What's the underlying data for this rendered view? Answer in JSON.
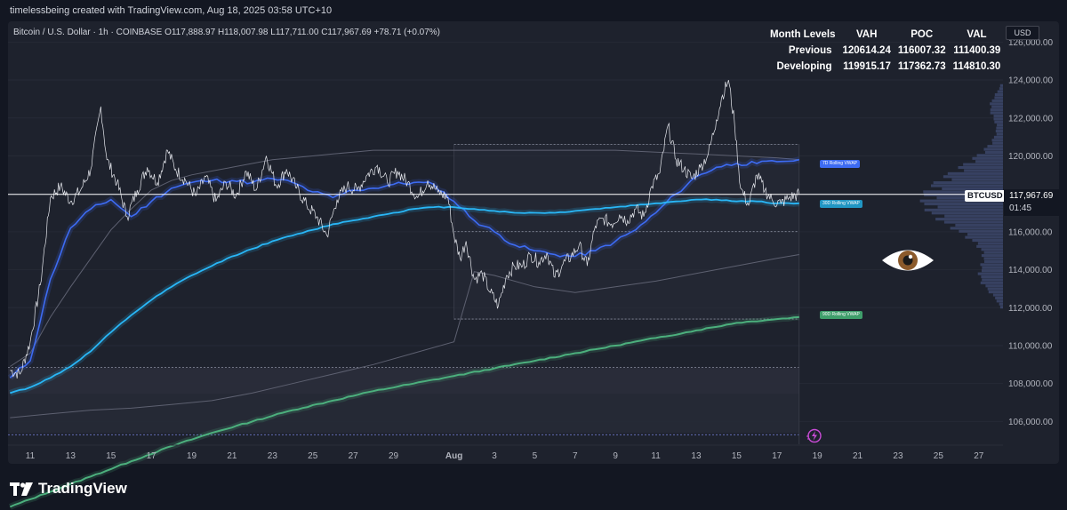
{
  "header": {
    "credit": "timelessbeing created with TradingView.com, Aug 18, 2025 03:58 UTC+10"
  },
  "legend": {
    "symbol": "Bitcoin / U.S. Dollar · 1h · COINBASE",
    "o_label": "O",
    "o_value": "117,888.97",
    "h_label": "H",
    "h_value": "118,007.98",
    "l_label": "L",
    "l_value": "117,711.00",
    "c_label": "C",
    "c_value": "117,967.69",
    "change": "+78.71 (+0.07%)"
  },
  "month_levels": {
    "headers": [
      "Month Levels",
      "VAH",
      "POC",
      "VAL"
    ],
    "rows": [
      {
        "name": "Previous",
        "vah": "120614.24",
        "poc": "116007.32",
        "val": "111400.39"
      },
      {
        "name": "Developing",
        "vah": "119915.17",
        "poc": "117362.73",
        "val": "114810.30"
      }
    ]
  },
  "price_scale": {
    "currency": "USD",
    "current_price": "117,967.69",
    "countdown": "01:45",
    "symbol_tag": "BTCUSD"
  },
  "vwap_tags": {
    "d7": "7D Rolling VWAP",
    "d30": "30D Rolling VWAP",
    "d90": "90D Rolling VWAP"
  },
  "footer": {
    "brand": "TradingView"
  },
  "icons": {
    "eye": "eye-icon",
    "bolt": "lightning-icon",
    "logo": "tradingview-logo-icon"
  },
  "colors": {
    "background": "#131722",
    "panel": "#1e222d",
    "vwap_7d": "#3d6bf2",
    "vwap_30d": "#29b6f6",
    "vwap_90d": "#4caf7d",
    "price_line": "#ffffff"
  },
  "chart_data": {
    "type": "line",
    "y_ticks": [
      106000,
      108000,
      110000,
      112000,
      114000,
      116000,
      118000,
      120000,
      122000,
      124000,
      126000
    ],
    "y_tick_labels": [
      "106,000.00",
      "108,000.00",
      "110,000.00",
      "112,000.00",
      "114,000.00",
      "116,000.00",
      "118,000.00",
      "120,000.00",
      "122,000.00",
      "124,000.00",
      "126,000.00"
    ],
    "ylim": [
      104800,
      127000
    ],
    "x_tick_labels": [
      "11",
      "13",
      "15",
      "17",
      "19",
      "21",
      "23",
      "25",
      "27",
      "29",
      "Aug",
      "3",
      "5",
      "7",
      "9",
      "11",
      "13",
      "15",
      "17",
      "19",
      "21",
      "23",
      "25",
      "27"
    ],
    "x_tick_days": [
      11,
      13,
      15,
      17,
      19,
      21,
      23,
      25,
      27,
      29,
      32,
      34,
      36,
      38,
      40,
      42,
      44,
      46,
      48,
      50,
      52,
      54,
      56,
      58
    ],
    "xlim": [
      9.9,
      59.2
    ],
    "last_day": 49.1,
    "price_series": [
      [
        10.0,
        108700
      ],
      [
        10.5,
        108500
      ],
      [
        11.0,
        110200
      ],
      [
        11.5,
        113200
      ],
      [
        12.0,
        117800
      ],
      [
        12.5,
        118400
      ],
      [
        13.0,
        117600
      ],
      [
        13.5,
        118200
      ],
      [
        14.0,
        119300
      ],
      [
        14.5,
        122600
      ],
      [
        14.8,
        119800
      ],
      [
        15.3,
        118600
      ],
      [
        15.8,
        116800
      ],
      [
        16.3,
        118200
      ],
      [
        16.8,
        119400
      ],
      [
        17.3,
        118600
      ],
      [
        17.8,
        120300
      ],
      [
        18.2,
        119300
      ],
      [
        18.7,
        118700
      ],
      [
        19.2,
        117900
      ],
      [
        19.7,
        118900
      ],
      [
        20.2,
        117600
      ],
      [
        20.7,
        118600
      ],
      [
        21.2,
        117900
      ],
      [
        21.7,
        119200
      ],
      [
        22.2,
        118200
      ],
      [
        22.7,
        120000
      ],
      [
        23.2,
        118400
      ],
      [
        23.7,
        119300
      ],
      [
        24.2,
        118300
      ],
      [
        24.7,
        117400
      ],
      [
        25.2,
        116800
      ],
      [
        25.7,
        115800
      ],
      [
        26.2,
        117700
      ],
      [
        26.7,
        118400
      ],
      [
        27.2,
        118200
      ],
      [
        27.7,
        119000
      ],
      [
        28.2,
        119500
      ],
      [
        28.7,
        118600
      ],
      [
        29.2,
        119200
      ],
      [
        29.7,
        118600
      ],
      [
        30.2,
        117800
      ],
      [
        30.7,
        118700
      ],
      [
        31.2,
        118100
      ],
      [
        31.7,
        117800
      ],
      [
        32.0,
        115800
      ],
      [
        32.3,
        114600
      ],
      [
        32.6,
        115500
      ],
      [
        33.0,
        113500
      ],
      [
        33.4,
        113800
      ],
      [
        33.8,
        112800
      ],
      [
        34.2,
        112100
      ],
      [
        34.6,
        113700
      ],
      [
        35.0,
        114200
      ],
      [
        35.4,
        114200
      ],
      [
        35.8,
        114800
      ],
      [
        36.2,
        114400
      ],
      [
        36.6,
        114900
      ],
      [
        37.0,
        113600
      ],
      [
        37.4,
        114300
      ],
      [
        37.8,
        114700
      ],
      [
        38.2,
        115300
      ],
      [
        38.6,
        114200
      ],
      [
        39.0,
        116300
      ],
      [
        39.4,
        116700
      ],
      [
        39.8,
        116400
      ],
      [
        40.2,
        116900
      ],
      [
        40.6,
        116600
      ],
      [
        41.0,
        117200
      ],
      [
        41.4,
        116800
      ],
      [
        41.8,
        118400
      ],
      [
        42.2,
        119100
      ],
      [
        42.6,
        121600
      ],
      [
        43.0,
        119800
      ],
      [
        43.4,
        119300
      ],
      [
        43.8,
        118800
      ],
      [
        44.2,
        119400
      ],
      [
        44.6,
        120100
      ],
      [
        45.0,
        121900
      ],
      [
        45.3,
        123200
      ],
      [
        45.6,
        124000
      ],
      [
        45.9,
        121700
      ],
      [
        46.2,
        118300
      ],
      [
        46.6,
        117400
      ],
      [
        47.0,
        119000
      ],
      [
        47.4,
        118200
      ],
      [
        47.8,
        117600
      ],
      [
        48.2,
        117500
      ],
      [
        48.6,
        117800
      ],
      [
        49.1,
        117970
      ]
    ],
    "series": [
      {
        "name": "7D Rolling VWAP",
        "values": [
          [
            10.0,
            108300
          ],
          [
            11.0,
            109200
          ],
          [
            12.0,
            113500
          ],
          [
            13.0,
            116200
          ],
          [
            14.0,
            117200
          ],
          [
            15.0,
            117700
          ],
          [
            16.0,
            116800
          ],
          [
            17.0,
            117600
          ],
          [
            18.0,
            118300
          ],
          [
            19.0,
            118600
          ],
          [
            20.0,
            118700
          ],
          [
            21.0,
            118700
          ],
          [
            22.0,
            118600
          ],
          [
            23.0,
            118800
          ],
          [
            24.0,
            118600
          ],
          [
            25.0,
            118100
          ],
          [
            26.0,
            117800
          ],
          [
            27.0,
            118200
          ],
          [
            28.0,
            118300
          ],
          [
            29.0,
            118500
          ],
          [
            30.0,
            118600
          ],
          [
            31.0,
            118500
          ],
          [
            32.0,
            117600
          ],
          [
            33.0,
            116600
          ],
          [
            34.0,
            116000
          ],
          [
            35.0,
            115300
          ],
          [
            36.0,
            115000
          ],
          [
            37.0,
            114800
          ],
          [
            38.0,
            114700
          ],
          [
            39.0,
            115000
          ],
          [
            40.0,
            115500
          ],
          [
            41.0,
            116100
          ],
          [
            42.0,
            117000
          ],
          [
            43.0,
            118000
          ],
          [
            44.0,
            118900
          ],
          [
            45.0,
            119400
          ],
          [
            46.0,
            119600
          ],
          [
            47.0,
            119600
          ],
          [
            48.0,
            119700
          ],
          [
            49.1,
            119800
          ]
        ]
      },
      {
        "name": "30D Rolling VWAP",
        "values": [
          [
            10.0,
            107500
          ],
          [
            11.0,
            107800
          ],
          [
            12.0,
            108300
          ],
          [
            13.0,
            108900
          ],
          [
            14.0,
            109700
          ],
          [
            15.0,
            110700
          ],
          [
            16.0,
            111600
          ],
          [
            17.0,
            112400
          ],
          [
            18.0,
            113100
          ],
          [
            19.0,
            113700
          ],
          [
            20.0,
            114200
          ],
          [
            21.0,
            114700
          ],
          [
            22.0,
            115100
          ],
          [
            23.0,
            115500
          ],
          [
            24.0,
            115800
          ],
          [
            25.0,
            116100
          ],
          [
            26.0,
            116400
          ],
          [
            27.0,
            116600
          ],
          [
            28.0,
            116800
          ],
          [
            29.0,
            117000
          ],
          [
            30.0,
            117200
          ],
          [
            31.0,
            117300
          ],
          [
            32.0,
            117300
          ],
          [
            33.0,
            117200
          ],
          [
            34.0,
            117100
          ],
          [
            35.0,
            117000
          ],
          [
            36.0,
            117000
          ],
          [
            37.0,
            117000
          ],
          [
            38.0,
            117100
          ],
          [
            39.0,
            117200
          ],
          [
            40.0,
            117300
          ],
          [
            41.0,
            117400
          ],
          [
            42.0,
            117500
          ],
          [
            43.0,
            117600
          ],
          [
            44.0,
            117700
          ],
          [
            45.0,
            117700
          ],
          [
            46.0,
            117600
          ],
          [
            47.0,
            117600
          ],
          [
            48.0,
            117500
          ],
          [
            49.1,
            117500
          ]
        ]
      },
      {
        "name": "90D Rolling VWAP",
        "values": [
          [
            10.0,
            101500
          ],
          [
            12.0,
            102300
          ],
          [
            14.0,
            103100
          ],
          [
            16.0,
            103900
          ],
          [
            18.0,
            104700
          ],
          [
            20.0,
            105400
          ],
          [
            22.0,
            106000
          ],
          [
            24.0,
            106600
          ],
          [
            26.0,
            107100
          ],
          [
            28.0,
            107600
          ],
          [
            30.0,
            108000
          ],
          [
            32.0,
            108400
          ],
          [
            34.0,
            108800
          ],
          [
            36.0,
            109200
          ],
          [
            38.0,
            109600
          ],
          [
            40.0,
            110000
          ],
          [
            42.0,
            110400
          ],
          [
            44.0,
            110800
          ],
          [
            46.0,
            111200
          ],
          [
            48.0,
            111400
          ],
          [
            49.1,
            111500
          ]
        ]
      },
      {
        "name": "30D upper band",
        "values": [
          [
            10.0,
            108900
          ],
          [
            11.0,
            109600
          ],
          [
            12.0,
            111500
          ],
          [
            13.0,
            113100
          ],
          [
            14.0,
            114600
          ],
          [
            15.0,
            116100
          ],
          [
            16.0,
            117200
          ],
          [
            17.0,
            118200
          ],
          [
            18.0,
            118700
          ],
          [
            19.0,
            119000
          ],
          [
            20.0,
            119200
          ],
          [
            21.0,
            119400
          ],
          [
            22.0,
            119600
          ],
          [
            23.0,
            119800
          ],
          [
            24.0,
            119900
          ],
          [
            25.0,
            120000
          ],
          [
            26.0,
            120100
          ],
          [
            27.0,
            120200
          ],
          [
            28.0,
            120300
          ],
          [
            29.0,
            120300
          ],
          [
            30.0,
            120300
          ],
          [
            31.0,
            120300
          ],
          [
            32.0,
            120300
          ],
          [
            34.0,
            120300
          ],
          [
            36.0,
            120300
          ],
          [
            38.0,
            120300
          ],
          [
            40.0,
            120300
          ],
          [
            42.0,
            120200
          ],
          [
            44.0,
            120100
          ],
          [
            46.0,
            120000
          ],
          [
            48.0,
            119900
          ],
          [
            49.1,
            119800
          ]
        ]
      },
      {
        "name": "30D lower band",
        "values": [
          [
            10.0,
            106200
          ],
          [
            12.0,
            106400
          ],
          [
            14.0,
            106600
          ],
          [
            16.0,
            106700
          ],
          [
            18.0,
            106900
          ],
          [
            20.0,
            107100
          ],
          [
            22.0,
            107500
          ],
          [
            24.0,
            108000
          ],
          [
            26.0,
            108500
          ],
          [
            28.0,
            109000
          ],
          [
            30.0,
            109600
          ],
          [
            32.0,
            110200
          ],
          [
            33.0,
            113900
          ],
          [
            34.0,
            113700
          ],
          [
            36.0,
            113100
          ],
          [
            38.0,
            112800
          ],
          [
            40.0,
            113100
          ],
          [
            42.0,
            113400
          ],
          [
            44.0,
            113800
          ],
          [
            46.0,
            114200
          ],
          [
            48.0,
            114600
          ],
          [
            49.1,
            114800
          ]
        ]
      }
    ],
    "levels": [
      {
        "name": "Previous VAH",
        "value": 120614.24
      },
      {
        "name": "Previous POC",
        "value": 116007.32
      },
      {
        "name": "Previous VAL",
        "value": 111400.39
      }
    ],
    "grid": true,
    "legend": "top-left"
  }
}
